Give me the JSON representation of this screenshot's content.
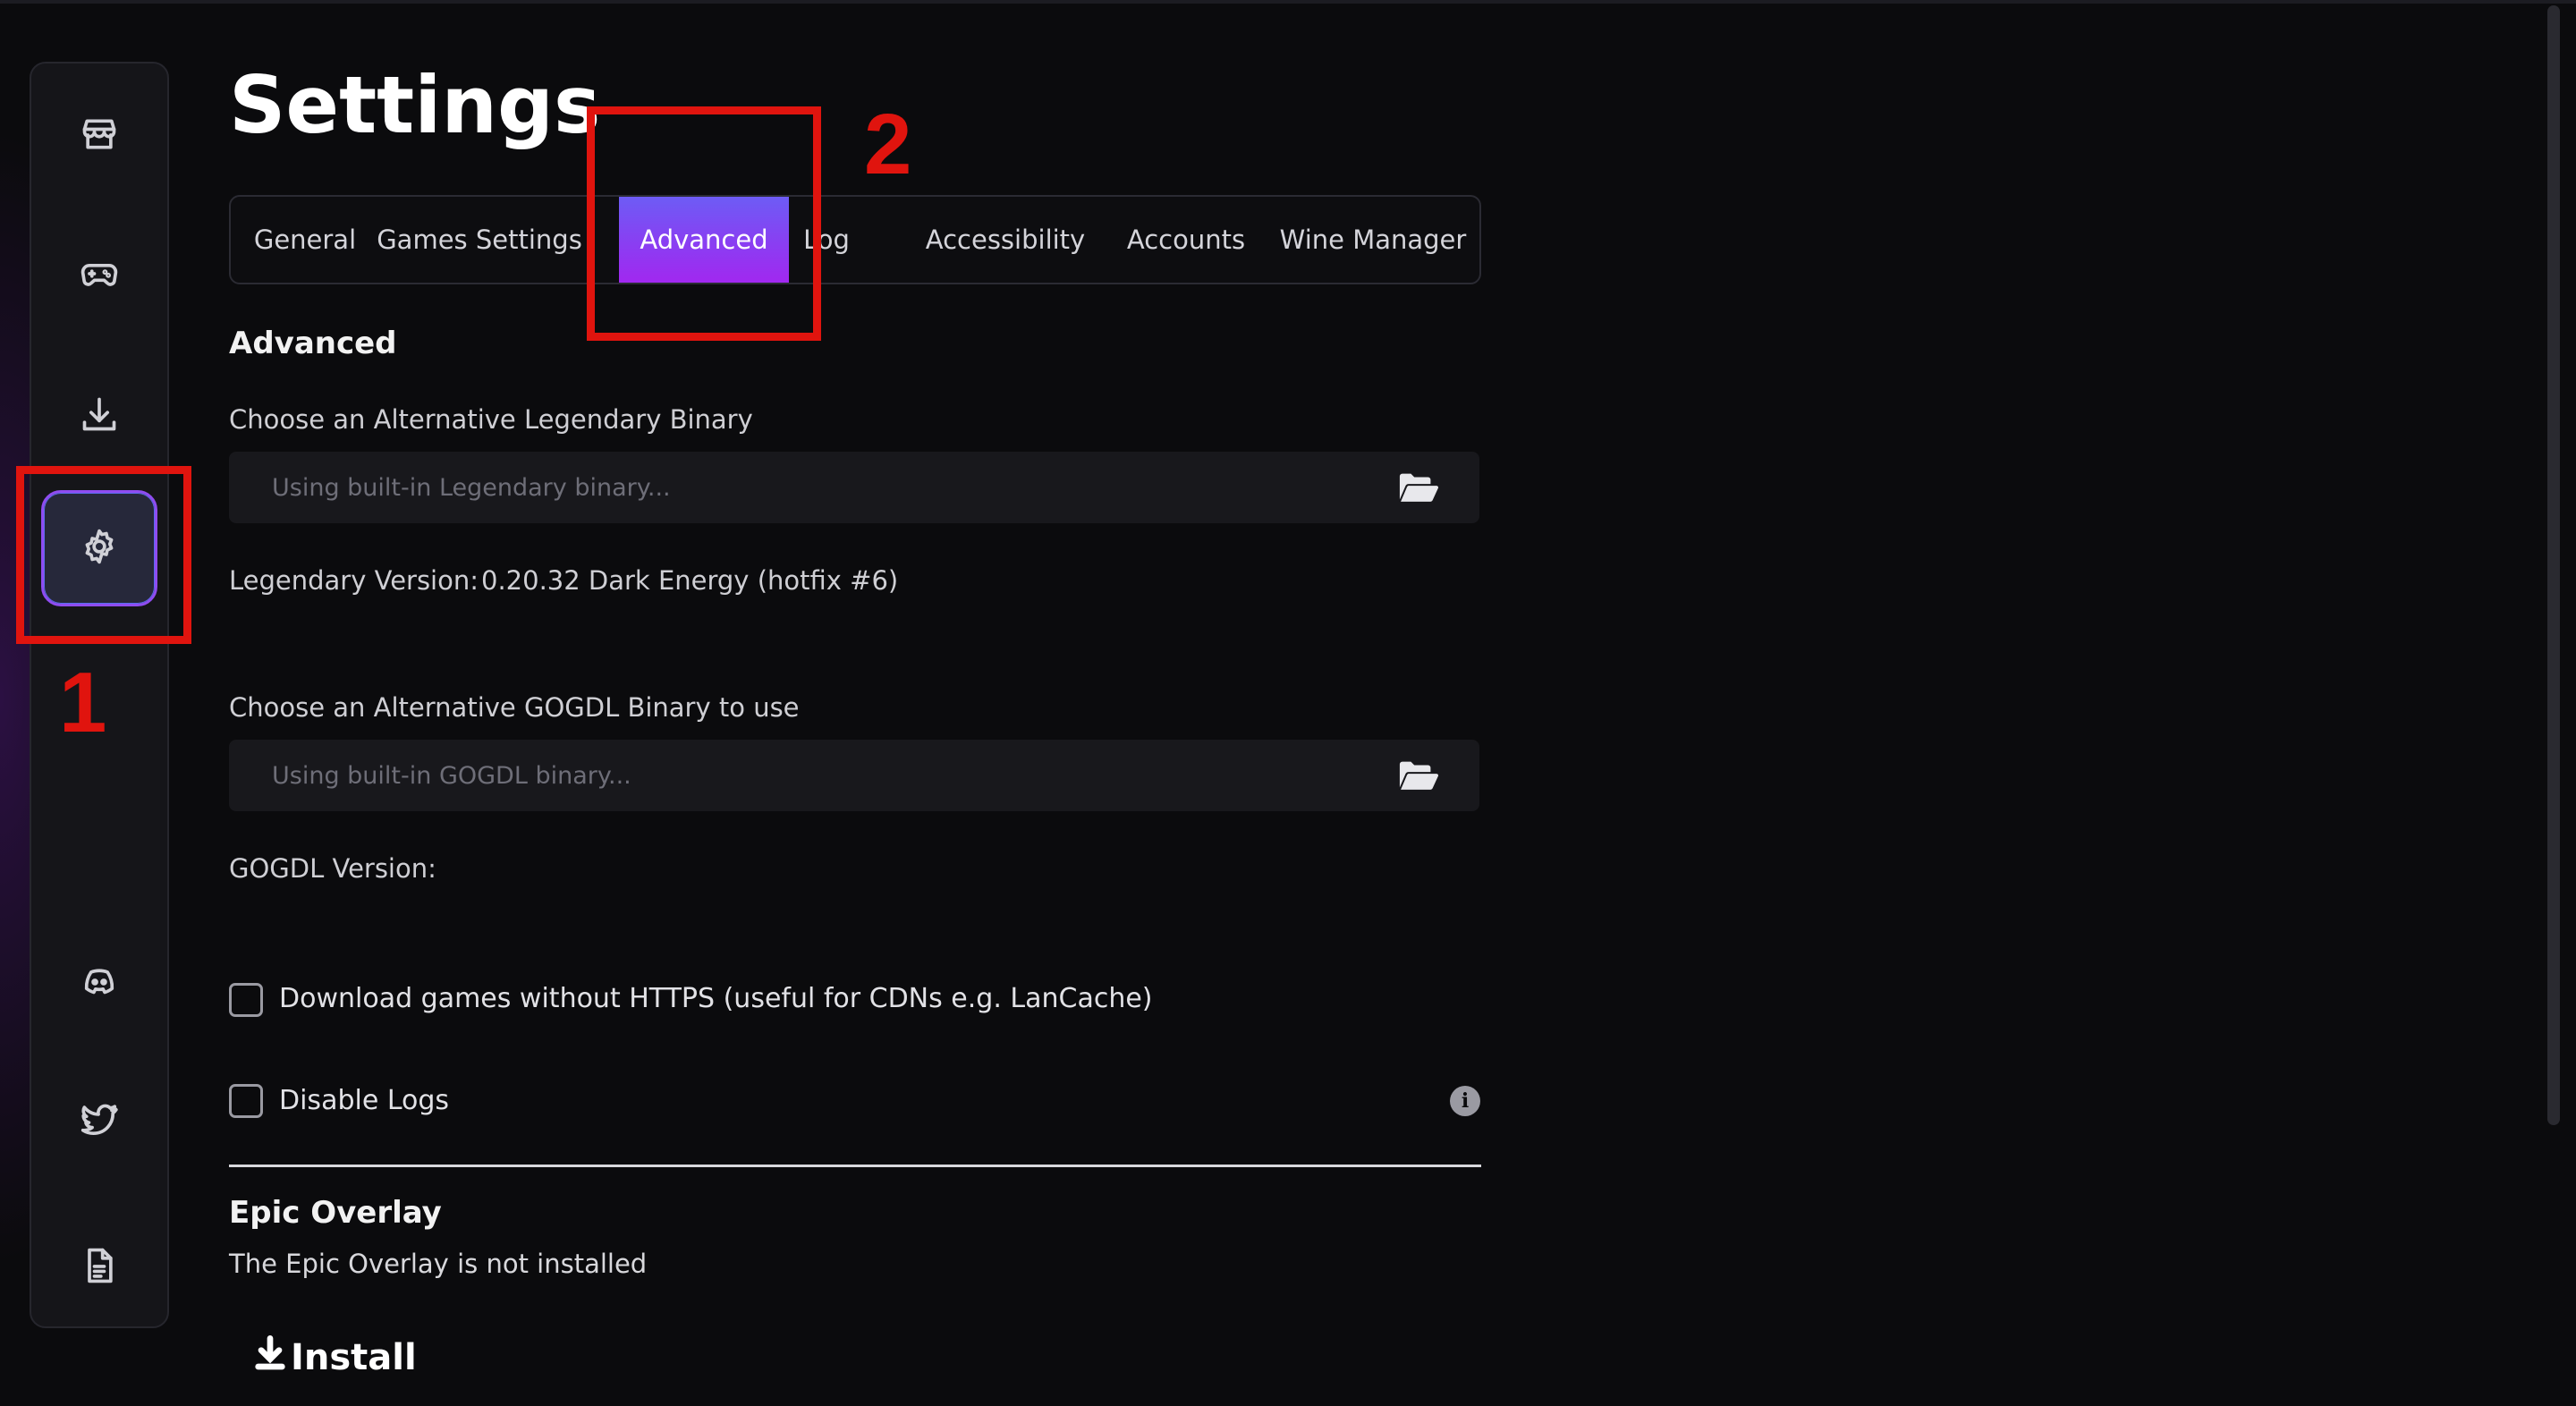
{
  "page": {
    "title": "Settings"
  },
  "sidebar": {
    "items": [
      {
        "name": "store",
        "icon": "store-icon"
      },
      {
        "name": "library",
        "icon": "gamepad-icon"
      },
      {
        "name": "downloads",
        "icon": "download-icon"
      },
      {
        "name": "settings",
        "icon": "gear-icon",
        "active": true
      },
      {
        "name": "discord",
        "icon": "discord-icon"
      },
      {
        "name": "twitter",
        "icon": "twitter-icon"
      },
      {
        "name": "docs",
        "icon": "document-icon"
      }
    ]
  },
  "annotations": {
    "marker_1": "1",
    "marker_2": "2",
    "color": "#e0140e"
  },
  "tabs": [
    {
      "label": "General"
    },
    {
      "label": "Games Settings"
    },
    {
      "label": "Advanced",
      "active": true
    },
    {
      "label": "Log"
    },
    {
      "label": "Accessibility"
    },
    {
      "label": "Accounts"
    },
    {
      "label": "Wine Manager"
    }
  ],
  "advanced": {
    "heading": "Advanced",
    "legendary_label": "Choose an Alternative Legendary Binary",
    "legendary_placeholder": "Using built-in Legendary binary...",
    "legendary_version_label": "Legendary Version:",
    "legendary_version_value": "0.20.32 Dark Energy (hotfix #6)",
    "gogdl_label": "Choose an Alternative GOGDL Binary to use",
    "gogdl_placeholder": "Using built-in GOGDL binary...",
    "gogdl_version_label": "GOGDL Version:",
    "no_https_label": "Download games without HTTPS (useful for CDNs e.g. LanCache)",
    "disable_logs_label": "Disable Logs"
  },
  "epic_overlay": {
    "heading": "Epic Overlay",
    "status": "The Epic Overlay is not installed",
    "install_label": "Install"
  },
  "colors": {
    "accent_start": "#6d5cf5",
    "accent_end": "#a128f0",
    "background": "#0b0b0d",
    "sidebar": "#151519"
  }
}
